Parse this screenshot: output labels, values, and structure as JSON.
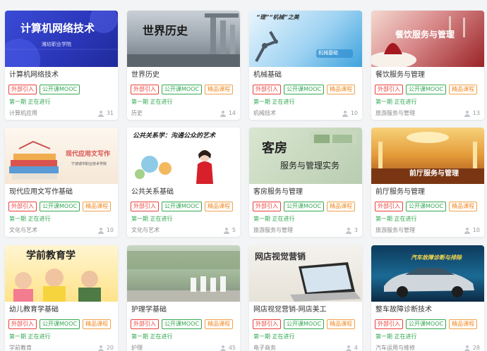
{
  "tags": {
    "external": "外部引入",
    "mooc": "公开课MOOC",
    "quality": "精品课程"
  },
  "courses": [
    {
      "name": "计算机网络技术",
      "status": "第一期 正在进行",
      "category": "计算机应用",
      "count": "31",
      "cover": {
        "title": "计算机网络技术",
        "subtitle": "潍坊职业学院",
        "theme": "blue-banner-icon"
      }
    },
    {
      "name": "世界历史",
      "status": "第一期 正在进行",
      "category": "历史",
      "count": "14",
      "cover": {
        "title": "世界历史",
        "subtitle": "",
        "theme": "ancient-ruins-icon"
      }
    },
    {
      "name": "机械基础",
      "status": "第一期 正在进行",
      "category": "机械技术",
      "count": "10",
      "cover": {
        "title": "“理”“机械”之美",
        "subtitle": "机械基础",
        "theme": "robot-arm-icon"
      }
    },
    {
      "name": "餐饮服务与管理",
      "status": "第一期 正在进行",
      "category": "旅游服务与管理",
      "count": "13",
      "cover": {
        "title": "餐饮服务与管理",
        "subtitle": "",
        "theme": "dining-table-icon"
      }
    },
    {
      "name": "现代应用文写作基础",
      "status": "第一期 正在进行",
      "category": "文化与艺术",
      "count": "10",
      "cover": {
        "title": "现代应用文写作",
        "subtitle": "宁波城市职业技术学院",
        "theme": "books-icon"
      }
    },
    {
      "name": "公共关系基础",
      "status": "第一期 正在进行",
      "category": "文化与艺术",
      "count": "5",
      "cover": {
        "title": "公共关系学：沟通公众的艺术",
        "subtitle": "",
        "theme": "presenter-icon"
      }
    },
    {
      "name": "客房服务与管理",
      "status": "第一期 正在进行",
      "category": "旅游服务与管理",
      "count": "3",
      "cover": {
        "title": "客房",
        "subtitle": "服务与管理实务",
        "theme": "hotel-room-icon"
      }
    },
    {
      "name": "前厅服务与管理",
      "status": "第一期 正在进行",
      "category": "旅游服务与管理",
      "count": "10",
      "cover": {
        "title": "前厅服务与管理",
        "subtitle": "",
        "theme": "hotel-lobby-icon"
      }
    },
    {
      "name": "幼儿教育学基础",
      "status": "第一期 正在进行",
      "category": "学前教育",
      "count": "20",
      "cover": {
        "title": "学前教育学",
        "subtitle": "",
        "theme": "children-icon"
      }
    },
    {
      "name": "护理学基础",
      "status": "第一期 正在进行",
      "category": "护理",
      "count": "45",
      "cover": {
        "title": "",
        "subtitle": "",
        "theme": "nurses-icon"
      }
    },
    {
      "name": "网店视觉营销-网店美工",
      "status": "第一期 正在进行",
      "category": "电子商务",
      "count": "4",
      "cover": {
        "title": "网店视觉营销",
        "subtitle": "",
        "theme": "laptop-icon"
      }
    },
    {
      "name": "整车故障诊断技术",
      "status": "第一期 正在进行",
      "category": "汽车运用与维修",
      "count": "28",
      "cover": {
        "title": "汽车故障诊断与排除",
        "subtitle": "",
        "theme": "car-icon"
      }
    }
  ]
}
